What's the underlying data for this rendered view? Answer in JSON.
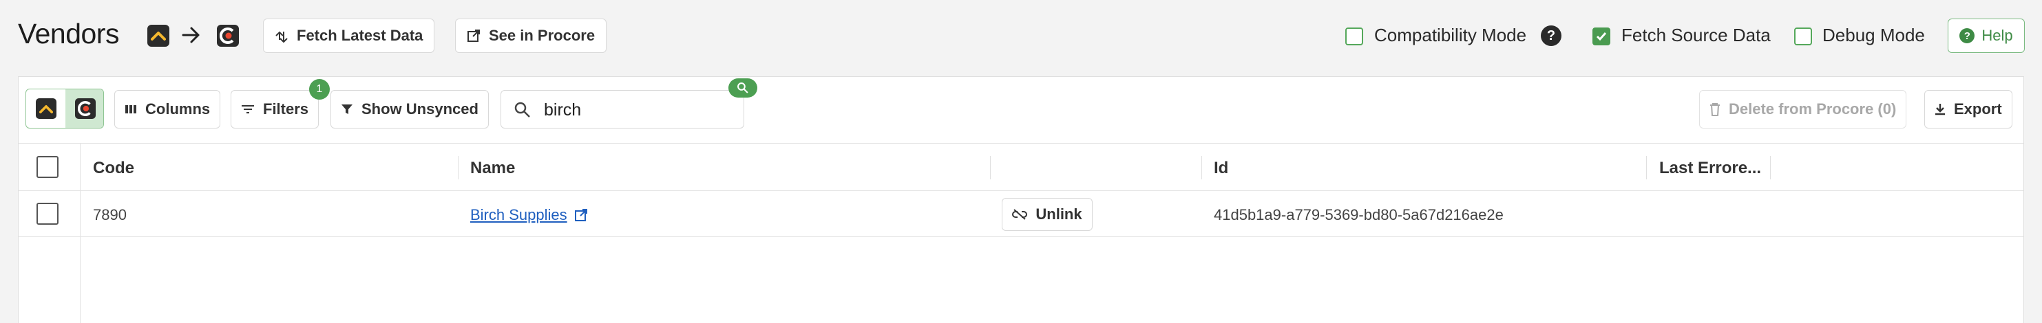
{
  "header": {
    "title": "Vendors",
    "source_logo": "procore-source-icon",
    "target_logo": "procore-target-icon",
    "fetch_latest_label": "Fetch Latest Data",
    "see_in_procore_label": "See in Procore",
    "compatibility_mode": {
      "label": "Compatibility Mode",
      "checked": false
    },
    "fetch_source_data": {
      "label": "Fetch Source Data",
      "checked": true
    },
    "debug_mode": {
      "label": "Debug Mode",
      "checked": false
    },
    "help_label": "Help"
  },
  "toolbar": {
    "columns_label": "Columns",
    "filters_label": "Filters",
    "filters_count": "1",
    "show_unsynced_label": "Show Unsynced",
    "search_value": "birch",
    "delete_label": "Delete from Procore (0)",
    "export_label": "Export"
  },
  "table": {
    "columns": [
      "Code",
      "Name",
      "",
      "Id",
      "Last Errore..."
    ],
    "rows": [
      {
        "code": "7890",
        "name": "Birch Supplies",
        "action": "Unlink",
        "id": "41d5b1a9-a779-5369-bd80-5a67d216ae2e",
        "last_error": ""
      }
    ]
  },
  "colors": {
    "accent_green": "#4c9f52",
    "link_blue": "#1f5fbf",
    "logo_dark": "#2b2b2b",
    "logo_yellow": "#f5b82e",
    "logo_red": "#e8462f"
  }
}
